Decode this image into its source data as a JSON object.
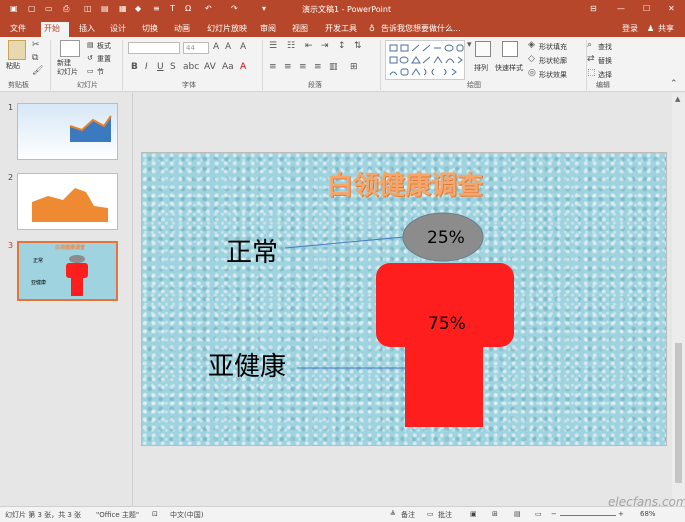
{
  "window": {
    "title": "演示文稿1 - PowerPoint",
    "login": "登录",
    "share": "共享"
  },
  "tabs": [
    "文件",
    "开始",
    "插入",
    "设计",
    "切换",
    "动画",
    "幻灯片放映",
    "审阅",
    "视图",
    "开发工具"
  ],
  "tell_me": "告诉我您想要做什么...",
  "ribbon": {
    "paste": "粘贴",
    "clipboard": "剪贴板",
    "new_slide": "新建\n幻灯片",
    "layout": "板式",
    "reset": "重置",
    "section": "节",
    "slides_group": "幻灯片",
    "font_size": "44",
    "font_group": "字体",
    "para_group": "段落",
    "drawing_group": "绘图",
    "arrange": "排列",
    "quick_styles": "快速样式",
    "shape_fill": "形状填充",
    "shape_outline": "形状轮廓",
    "shape_effect": "形状效果",
    "find": "查找",
    "replace": "替换",
    "select": "选择",
    "edit_group": "编辑"
  },
  "slides": [
    {
      "num": "1"
    },
    {
      "num": "2"
    },
    {
      "num": "3",
      "title": "白领健康调查",
      "l1": "正常",
      "l2": "亚健康",
      "p1": "25%",
      "p2": "75%"
    }
  ],
  "slide": {
    "title": "白领健康调查",
    "label_normal": "正常",
    "label_sub": "亚健康",
    "pct_normal": "25%",
    "pct_sub": "75%"
  },
  "chart_data": {
    "type": "pie",
    "title": "白领健康调查",
    "categories": [
      "正常",
      "亚健康"
    ],
    "values": [
      25,
      75
    ],
    "colors": [
      "#8c8c8c",
      "#ff1e1e"
    ]
  },
  "status": {
    "slide_info": "幻灯片 第 3 张，共 3 张",
    "theme": "\"Office 主题\"",
    "lang": "中文(中国)",
    "notes": "备注",
    "comments": "批注",
    "zoom": "68%",
    "watermark": "elecfans.com"
  }
}
